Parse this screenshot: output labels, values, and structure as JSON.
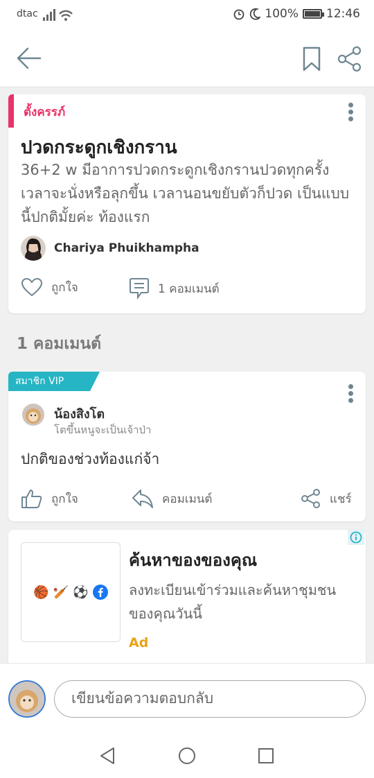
{
  "status_bar": {
    "carrier": "dtac",
    "battery": "100%",
    "battery_level": 1.0,
    "time": "12:46"
  },
  "post": {
    "tag": "ตั้งครรภ์",
    "title": "ปวดกระดูกเชิงกราน",
    "body": "36+2 w มีอาการปวดกระดูกเชิงกรานปวดทุกครั้งเวลาจะนั่งหรือลุกขึ้น เวลานอนขยับตัวก็ปวด เป็นแบบนี้ปกติมั้ยค่ะ ท้องแรก",
    "author": "Chariya Phuikhampha",
    "like_label": "ถูกใจ",
    "comment_label": "1 คอมเมนต์"
  },
  "comment_count": "1 คอมเมนต์",
  "comment": {
    "badge": "สมาชิก VIP",
    "author": "น้องสิงโต",
    "subtitle": "โตขึ้นหนูจะเป็นเจ้าป่า",
    "text": "ปกติของช่วงท้องแก่จ้า",
    "like_label": "ถูกใจ",
    "reply_label": "คอมเมนต์",
    "share_label": "แชร์"
  },
  "ad": {
    "title": "ค้นหาของของคุณ",
    "body": "ลงทะเบียนเข้าร่วมและค้นหาชุมชนของคุณวันนี้",
    "label": "Ad",
    "icons": [
      "🏀",
      "🏏",
      "⚽"
    ]
  },
  "reply_bar": {
    "placeholder": "เขียนข้อความตอบกลับ"
  },
  "colors": {
    "accent_pink": "#e8336a",
    "vip_teal": "#25b5c4",
    "ad_orange": "#e8a317"
  }
}
